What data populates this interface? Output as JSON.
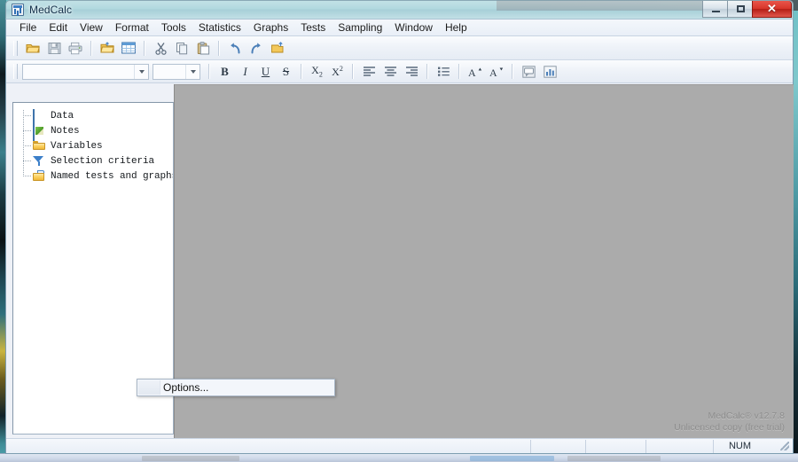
{
  "window": {
    "title": "MedCalc",
    "icon": "medcalc-app-icon",
    "controls": {
      "minimize": "minimize-button",
      "maximize": "maximize-button",
      "close_glyph": "✕"
    }
  },
  "menubar": {
    "items": [
      {
        "label": "File"
      },
      {
        "label": "Edit"
      },
      {
        "label": "View"
      },
      {
        "label": "Format"
      },
      {
        "label": "Tools"
      },
      {
        "label": "Statistics"
      },
      {
        "label": "Graphs"
      },
      {
        "label": "Tests"
      },
      {
        "label": "Sampling"
      },
      {
        "label": "Window"
      },
      {
        "label": "Help"
      }
    ]
  },
  "toolbar_main": {
    "buttons": [
      {
        "name": "open-folder-icon"
      },
      {
        "name": "save-icon"
      },
      {
        "name": "print-icon"
      },
      {
        "name": "open-file-icon"
      },
      {
        "name": "spreadsheet-icon"
      },
      {
        "name": "cut-icon"
      },
      {
        "name": "copy-icon"
      },
      {
        "name": "paste-icon"
      },
      {
        "name": "undo-icon"
      },
      {
        "name": "redo-icon"
      },
      {
        "name": "repeat-icon"
      }
    ]
  },
  "toolbar_format": {
    "font_combo": {
      "value": "",
      "placeholder": ""
    },
    "size_combo": {
      "value": "",
      "placeholder": ""
    },
    "bold_label": "B",
    "italic_label": "I",
    "underline_label": "U",
    "strike_label": "S",
    "subscript_label": "X",
    "subscript_index": "2",
    "superscript_label": "X",
    "superscript_index": "2",
    "buttons": [
      {
        "name": "align-left-icon"
      },
      {
        "name": "align-center-icon"
      },
      {
        "name": "align-right-icon"
      },
      {
        "name": "bullet-list-icon"
      },
      {
        "name": "grow-font-icon"
      },
      {
        "name": "shrink-font-icon"
      },
      {
        "name": "comment-icon"
      },
      {
        "name": "chart-icon"
      }
    ]
  },
  "tree": {
    "items": [
      {
        "label": "Data",
        "icon": "data-grid-icon"
      },
      {
        "label": "Notes",
        "icon": "notes-pencil-icon"
      },
      {
        "label": "Variables",
        "icon": "folder-icon"
      },
      {
        "label": "Selection criteria",
        "icon": "filter-funnel-icon"
      },
      {
        "label": "Named tests and graphs",
        "icon": "folder-document-icon"
      }
    ]
  },
  "context_menu": {
    "items": [
      {
        "label": "Options..."
      }
    ]
  },
  "mdi": {
    "branding_line1": "MedCalc® v12.7.8",
    "branding_line2": "Unlicensed copy (free trial)"
  },
  "statusbar": {
    "message": "",
    "panes": [
      {
        "label": ""
      },
      {
        "label": ""
      },
      {
        "label": ""
      },
      {
        "label": "NUM"
      },
      {
        "label": ""
      }
    ]
  },
  "colors": {
    "mdi_background": "#ababab",
    "close_button": "#d8362b",
    "folder_yellow": "#fcd262",
    "accent_blue": "#3c7fc9"
  }
}
